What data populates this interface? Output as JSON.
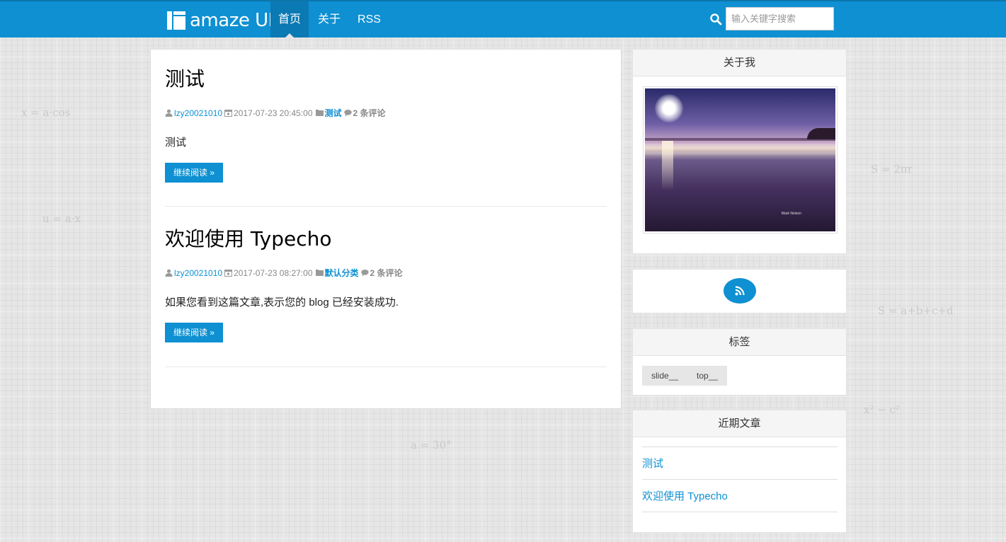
{
  "header": {
    "logo_text": "amaze UI",
    "nav": [
      {
        "label": "首页",
        "active": true
      },
      {
        "label": "关于",
        "active": false
      },
      {
        "label": "RSS",
        "active": false
      }
    ],
    "search_placeholder": "输入关键字搜索"
  },
  "posts": [
    {
      "title": "测试",
      "author": "lzy20021010",
      "date": "2017-07-23 20:45:00",
      "category": "测试",
      "comments": "2 条评论",
      "excerpt": "测试",
      "read_more": "继续阅读 »"
    },
    {
      "title": "欢迎使用 Typecho",
      "author": "lzy20021010",
      "date": "2017-07-23 08:27:00",
      "category": "默认分类",
      "comments": "2 条评论",
      "excerpt": "如果您看到这篇文章,表示您的 blog 已经安装成功.",
      "read_more": "继续阅读 »"
    }
  ],
  "sidebar": {
    "about_title": "关于我",
    "photo_caption": "Mark Nelson",
    "tags_title": "标签",
    "tags": [
      "slide__",
      "top__"
    ],
    "recent_title": "近期文章",
    "recent": [
      "测试",
      "欢迎使用 Typecho"
    ]
  },
  "colors": {
    "accent": "#0e90d2",
    "header_bg": "#0e90d2"
  },
  "icons": [
    "search-icon",
    "user-icon",
    "calendar-icon",
    "folder-icon",
    "comment-icon",
    "rss-icon"
  ]
}
